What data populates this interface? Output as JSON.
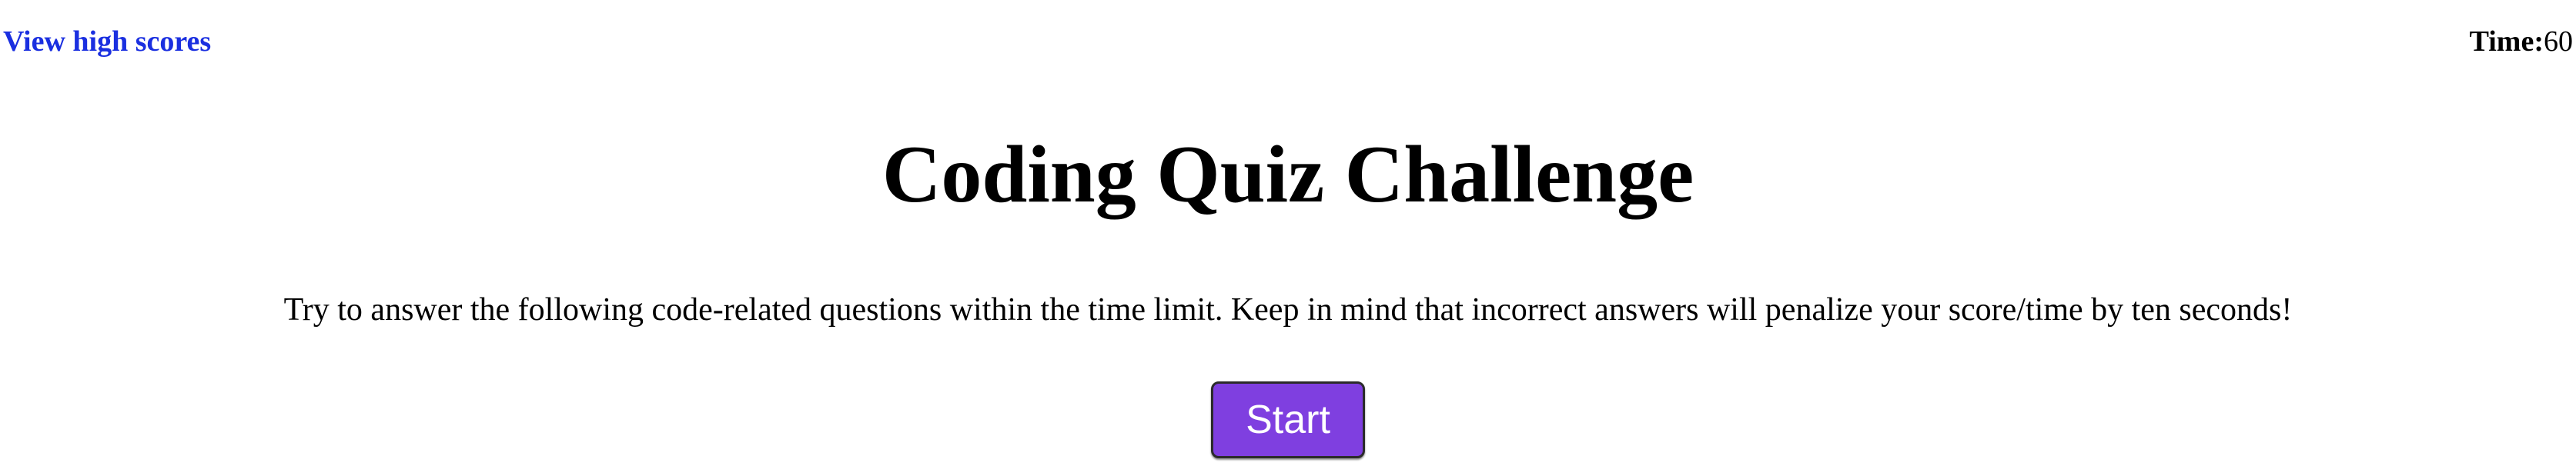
{
  "header": {
    "high_scores_link": "View high scores",
    "timer_label": "Time:",
    "timer_value": "60"
  },
  "main": {
    "title": "Coding Quiz Challenge",
    "description": "Try to answer the following code-related questions within the time limit. Keep in mind that incorrect answers will penalize your score/time by ten seconds!",
    "start_label": "Start"
  },
  "colors": {
    "link": "#1a2fe0",
    "start_button": "#7f3fe0",
    "start_button_text": "#ffffff"
  }
}
